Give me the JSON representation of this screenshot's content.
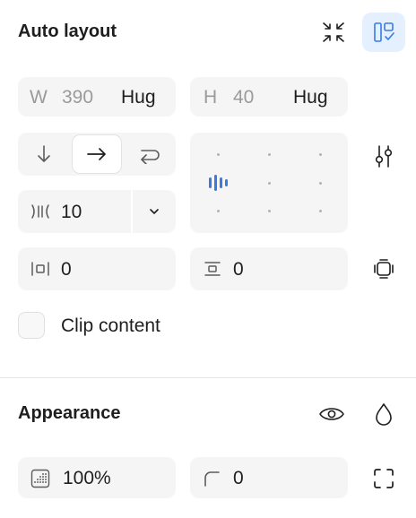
{
  "auto_layout": {
    "title": "Auto layout",
    "width": {
      "label": "W",
      "value": "390",
      "mode": "Hug"
    },
    "height": {
      "label": "H",
      "value": "40",
      "mode": "Hug"
    },
    "direction": {
      "options": [
        "down-arrow",
        "right-arrow",
        "wrap-arrow"
      ],
      "selected": "right-arrow"
    },
    "gap": {
      "value": "10"
    },
    "padding_horizontal": {
      "value": "0"
    },
    "padding_vertical": {
      "value": "0"
    },
    "clip_content": {
      "label": "Clip content",
      "checked": false
    }
  },
  "appearance": {
    "title": "Appearance",
    "opacity": {
      "value": "100%"
    },
    "corner_radius": {
      "value": "0"
    }
  },
  "colors": {
    "accent": "#3b7be0",
    "selected_bg": "#e5f0ff"
  }
}
